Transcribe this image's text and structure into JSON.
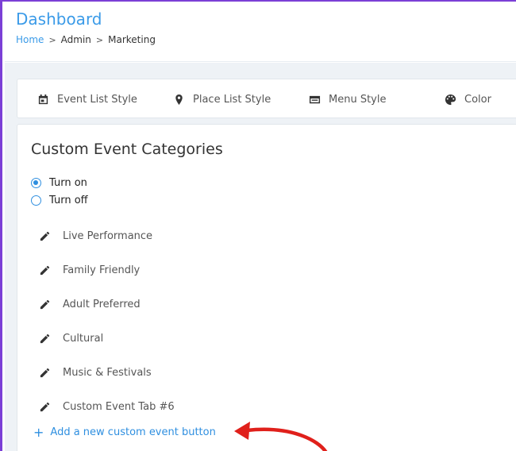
{
  "header": {
    "title": "Dashboard",
    "breadcrumb": {
      "home": "Home",
      "sep": ">",
      "admin": "Admin",
      "marketing": "Marketing"
    }
  },
  "tabs": [
    {
      "label": "Event List Style",
      "icon": "calendar-icon"
    },
    {
      "label": "Place List Style",
      "icon": "map-pin-icon"
    },
    {
      "label": "Menu Style",
      "icon": "menu-card-icon"
    },
    {
      "label": "Color",
      "icon": "palette-icon"
    }
  ],
  "card": {
    "title": "Custom Event Categories",
    "toggle": {
      "on_label": "Turn on",
      "off_label": "Turn off",
      "selected": "on"
    },
    "categories": [
      "Live Performance",
      "Family Friendly",
      "Adult Preferred",
      "Cultural",
      "Music & Festivals",
      "Custom Event Tab #6"
    ],
    "add_button": {
      "plus": "+",
      "label": "Add a new custom event button"
    }
  },
  "colors": {
    "accent": "#3b9be8",
    "frame": "#7b3fd6",
    "annotation": "#e0201b"
  }
}
